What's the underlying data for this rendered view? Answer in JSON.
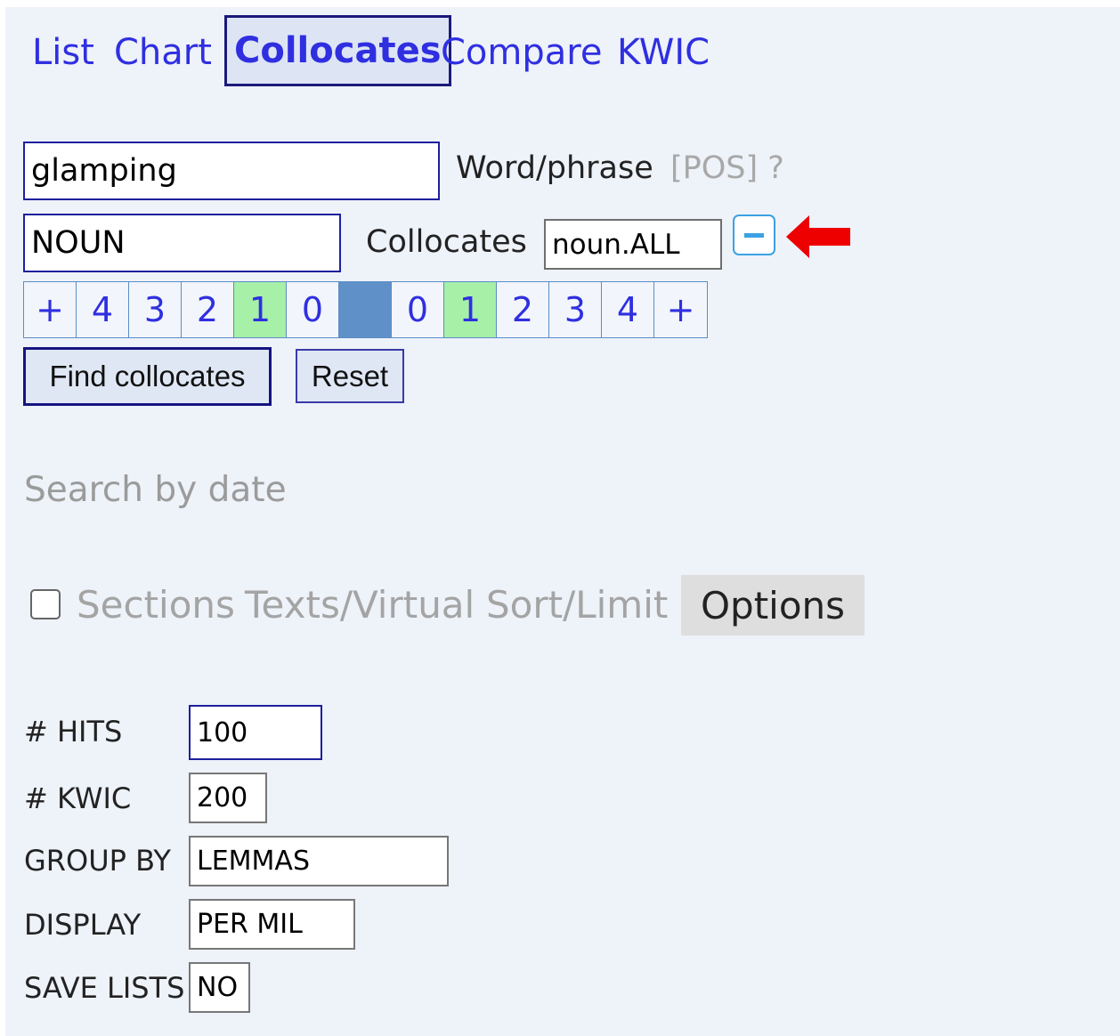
{
  "tabs": [
    "List",
    "Chart",
    "Collocates",
    "Compare",
    "KWIC"
  ],
  "active_tab": "Collocates",
  "search": {
    "word_value": "glamping",
    "word_label": "Word/phrase",
    "pos_hint": "[POS] ?",
    "pos_value": "NOUN",
    "collocates_label": "Collocates",
    "collocates_value": "noun.ALL"
  },
  "span": {
    "left": [
      "+",
      "4",
      "3",
      "2",
      "1",
      "0"
    ],
    "right": [
      "0",
      "1",
      "2",
      "3",
      "4",
      "+"
    ],
    "selected_left": "1",
    "selected_right": "1"
  },
  "buttons": {
    "find": "Find collocates",
    "reset": "Reset"
  },
  "search_by_date": "Search by date",
  "option_tabs": [
    "Sections",
    "Texts/Virtual",
    "Sort/Limit",
    "Options"
  ],
  "active_option_tab": "Options",
  "options": [
    {
      "label": "# HITS",
      "value": "100"
    },
    {
      "label": "# KWIC",
      "value": "200"
    },
    {
      "label": "GROUP BY",
      "value": "LEMMAS"
    },
    {
      "label": "DISPLAY",
      "value": "PER MIL"
    },
    {
      "label": "SAVE LISTS",
      "value": "NO"
    }
  ],
  "colors": {
    "link": "#2f2fe0",
    "selected_span": "#a6f0a8",
    "node_cell": "#6090c8",
    "annotation_arrow": "#ee0000"
  },
  "icons": {
    "collapse": "minus-icon",
    "annotation": "red-arrow-icon"
  }
}
